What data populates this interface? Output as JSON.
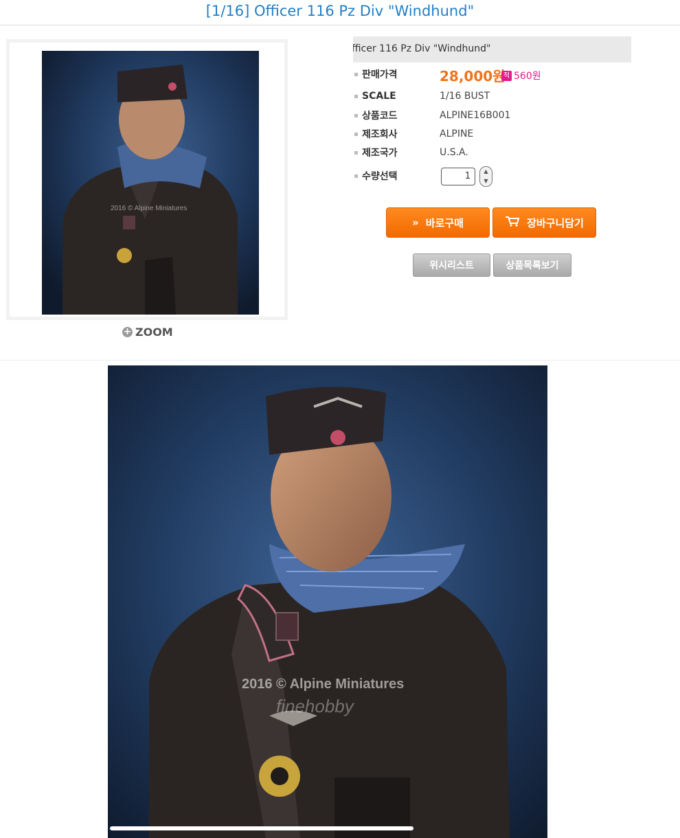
{
  "page": {
    "title": "[1/16] Officer 116 Pz Div \"Windhund\""
  },
  "gallery": {
    "zoom_label": "ZOOM",
    "watermark": "2016 © Alpine Miniatures",
    "watermark2": "finehobby"
  },
  "product": {
    "name": "fficer 116 Pz Div \"Windhund\"",
    "price_label": "판매가격",
    "price": "28,000원",
    "points_badge": "적",
    "points": "560원",
    "specs": [
      {
        "label": "SCALE",
        "value": "1/16 BUST"
      },
      {
        "label": "상품코드",
        "value": "ALPINE16B001"
      },
      {
        "label": "제조회사",
        "value": "ALPINE"
      },
      {
        "label": "제조국가",
        "value": "U.S.A."
      }
    ],
    "qty_label": "수량선택",
    "qty_value": "1"
  },
  "buttons": {
    "buy_now": "바로구매",
    "add_cart": "장바구니담기",
    "wishlist": "위시리스트",
    "product_list": "상품목록보기"
  },
  "colors": {
    "title_blue": "#1f7fc8",
    "price_orange": "#f07319",
    "points_pink": "#e5198a",
    "button_orange": "#f26a00"
  }
}
